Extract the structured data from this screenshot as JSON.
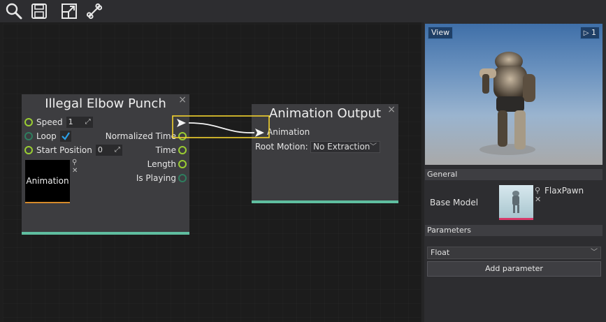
{
  "toolbar": {
    "icons": [
      "search-icon",
      "save-icon",
      "fit-view-icon",
      "bone-icon"
    ]
  },
  "nodes": {
    "sample": {
      "title": "Illegal Elbow Punch",
      "close": "×",
      "speed_label": "Speed",
      "speed_value": "1",
      "loop_label": "Loop",
      "loop_checked": true,
      "start_label": "Start Position",
      "start_value": "0",
      "normalized_time_label": "Normalized Time",
      "time_label": "Time",
      "length_label": "Length",
      "is_playing_label": "Is Playing",
      "animation_thumb_label": "Animation"
    },
    "output": {
      "title": "Animation Output",
      "close": "×",
      "animation_label": "Animation",
      "root_motion_label": "Root Motion:",
      "root_motion_value": "No Extraction"
    }
  },
  "viewport": {
    "view_label": "View",
    "camera_speed": "1"
  },
  "general": {
    "header": "General",
    "base_model_label": "Base Model",
    "base_model_value": "FlaxPawn"
  },
  "parameters": {
    "header": "Parameters",
    "type_value": "Float",
    "add_label": "Add parameter"
  },
  "colors": {
    "port_green": "#9acd32",
    "footer_teal": "#5fbea0",
    "selection_yellow": "#f2d22e",
    "check_blue": "#2b9fe6"
  }
}
